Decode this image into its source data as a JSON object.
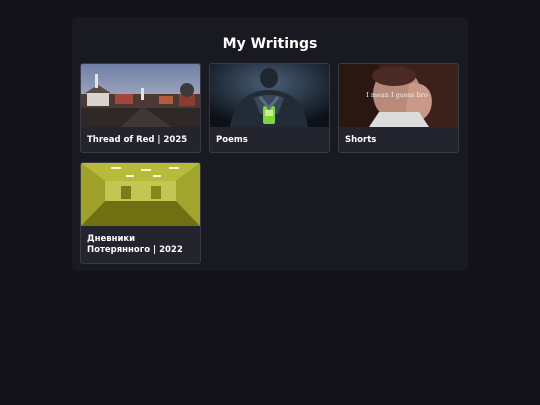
{
  "page": {
    "title": "My Writings"
  },
  "cards": [
    {
      "label": "Thread of Red | 2025",
      "image": "small-town-street-photo"
    },
    {
      "label": "Poems",
      "image": "praying-figure-photo"
    },
    {
      "label": "Shorts",
      "image": "man-facepalm-photo",
      "image_caption": "I mean I guess bro"
    },
    {
      "label": "Дневники Потерянного | 2022",
      "image": "backrooms-yellow-room-photo"
    }
  ]
}
